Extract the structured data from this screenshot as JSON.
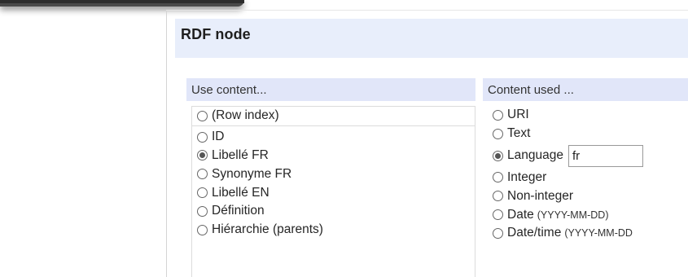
{
  "header": {
    "title": "RDF node"
  },
  "use_content": {
    "label": "Use content...",
    "options": [
      {
        "label": "(Row index)",
        "checked": false
      },
      {
        "label": "ID",
        "checked": false
      },
      {
        "label": "Libellé FR",
        "checked": true
      },
      {
        "label": "Synonyme FR",
        "checked": false
      },
      {
        "label": "Libellé EN",
        "checked": false
      },
      {
        "label": "Définition",
        "checked": false
      },
      {
        "label": "Hiérarchie (parents)",
        "checked": false
      }
    ]
  },
  "content_used": {
    "label": "Content used ...",
    "options": [
      {
        "label": "URI",
        "checked": false
      },
      {
        "label": "Text",
        "checked": false
      },
      {
        "label": "Language",
        "checked": true,
        "value": "fr"
      },
      {
        "label": "Integer",
        "checked": false
      },
      {
        "label": "Non-integer",
        "checked": false
      },
      {
        "label": "Date",
        "hint": "(YYYY-MM-DD)",
        "checked": false
      },
      {
        "label": "Date/time",
        "hint": "(YYYY-MM-DD",
        "checked": false
      }
    ]
  }
}
